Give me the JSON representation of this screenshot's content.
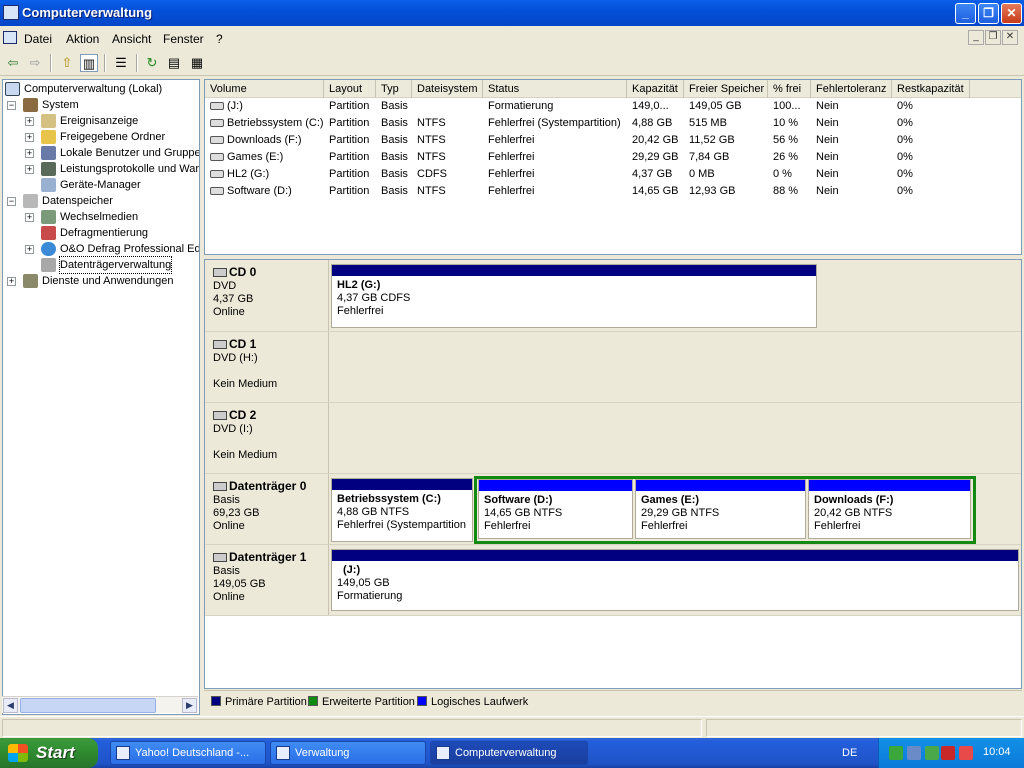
{
  "window": {
    "title": "Computerverwaltung"
  },
  "menu": {
    "items": [
      "Datei",
      "Aktion",
      "Ansicht",
      "Fenster",
      "?"
    ]
  },
  "tree": {
    "root": "Computerverwaltung (Lokal)",
    "system": "System",
    "system_children": [
      "Ereignisanzeige",
      "Freigegebene Ordner",
      "Lokale Benutzer und Gruppen",
      "Leistungsprotokolle und Warn",
      "Geräte-Manager"
    ],
    "storage": "Datenspeicher",
    "storage_children": [
      "Wechselmedien",
      "Defragmentierung",
      "O&O Defrag Professional Edi",
      "Datenträgerverwaltung"
    ],
    "services": "Dienste und Anwendungen"
  },
  "volumes": {
    "columns": [
      "Volume",
      "Layout",
      "Typ",
      "Dateisystem",
      "Status",
      "Kapazität",
      "Freier Speicher",
      "% frei",
      "Fehlertoleranz",
      "Restkapazität"
    ],
    "rows": [
      [
        "(J:)",
        "Partition",
        "Basis",
        "",
        "Formatierung",
        "149,0...",
        "149,05 GB",
        "100...",
        "Nein",
        "0%"
      ],
      [
        "Betriebssystem (C:)",
        "Partition",
        "Basis",
        "NTFS",
        "Fehlerfrei (Systempartition)",
        "4,88 GB",
        "515 MB",
        "10 %",
        "Nein",
        "0%"
      ],
      [
        "Downloads (F:)",
        "Partition",
        "Basis",
        "NTFS",
        "Fehlerfrei",
        "20,42 GB",
        "11,52 GB",
        "56 %",
        "Nein",
        "0%"
      ],
      [
        "Games (E:)",
        "Partition",
        "Basis",
        "NTFS",
        "Fehlerfrei",
        "29,29 GB",
        "7,84 GB",
        "26 %",
        "Nein",
        "0%"
      ],
      [
        "HL2 (G:)",
        "Partition",
        "Basis",
        "CDFS",
        "Fehlerfrei",
        "4,37 GB",
        "0 MB",
        "0 %",
        "Nein",
        "0%"
      ],
      [
        "Software (D:)",
        "Partition",
        "Basis",
        "NTFS",
        "Fehlerfrei",
        "14,65 GB",
        "12,93 GB",
        "88 %",
        "Nein",
        "0%"
      ]
    ]
  },
  "disks": [
    {
      "name": "CD 0",
      "l1": "DVD",
      "l2": "4,37 GB",
      "l3": "Online",
      "parts": [
        {
          "title": "HL2  (G:)",
          "size": "4,37 GB CDFS",
          "status": "Fehlerfrei"
        }
      ]
    },
    {
      "name": "CD 1",
      "l1": "DVD (H:)",
      "l2": "",
      "l3": "Kein Medium",
      "parts": []
    },
    {
      "name": "CD 2",
      "l1": "DVD (I:)",
      "l2": "",
      "l3": "Kein Medium",
      "parts": []
    },
    {
      "name": "Datenträger 0",
      "l1": "Basis",
      "l2": "69,23 GB",
      "l3": "Online",
      "parts": [
        {
          "title": "Betriebssystem  (C:)",
          "size": "4,88 GB NTFS",
          "status": "Fehlerfrei (Systempartition"
        },
        {
          "title": "Software  (D:)",
          "size": "14,65 GB NTFS",
          "status": "Fehlerfrei"
        },
        {
          "title": "Games  (E:)",
          "size": "29,29 GB NTFS",
          "status": "Fehlerfrei"
        },
        {
          "title": "Downloads  (F:)",
          "size": "20,42 GB NTFS",
          "status": "Fehlerfrei"
        }
      ]
    },
    {
      "name": "Datenträger 1",
      "l1": "Basis",
      "l2": "149,05 GB",
      "l3": "Online",
      "parts": [
        {
          "title": "(J:)",
          "size": "149,05 GB",
          "status": "Formatierung"
        }
      ]
    }
  ],
  "legend": [
    {
      "label": "Primäre Partition",
      "color": "#000080"
    },
    {
      "label": "Erweiterte Partition",
      "color": "#128a12"
    },
    {
      "label": "Logisches Laufwerk",
      "color": "#0000ff"
    }
  ],
  "taskbar": {
    "start": "Start",
    "tasks": [
      "Yahoo! Deutschland -...",
      "Verwaltung",
      "Computerverwaltung"
    ],
    "lang": "DE",
    "clock": "10:04"
  },
  "icons": [
    "computer-icon",
    "back-arrow-icon",
    "forward-arrow-icon",
    "up-folder-icon",
    "show-tree-icon",
    "properties-icon",
    "refresh-icon",
    "export-icon",
    "help-icon",
    "disk-icon",
    "cd-icon"
  ]
}
